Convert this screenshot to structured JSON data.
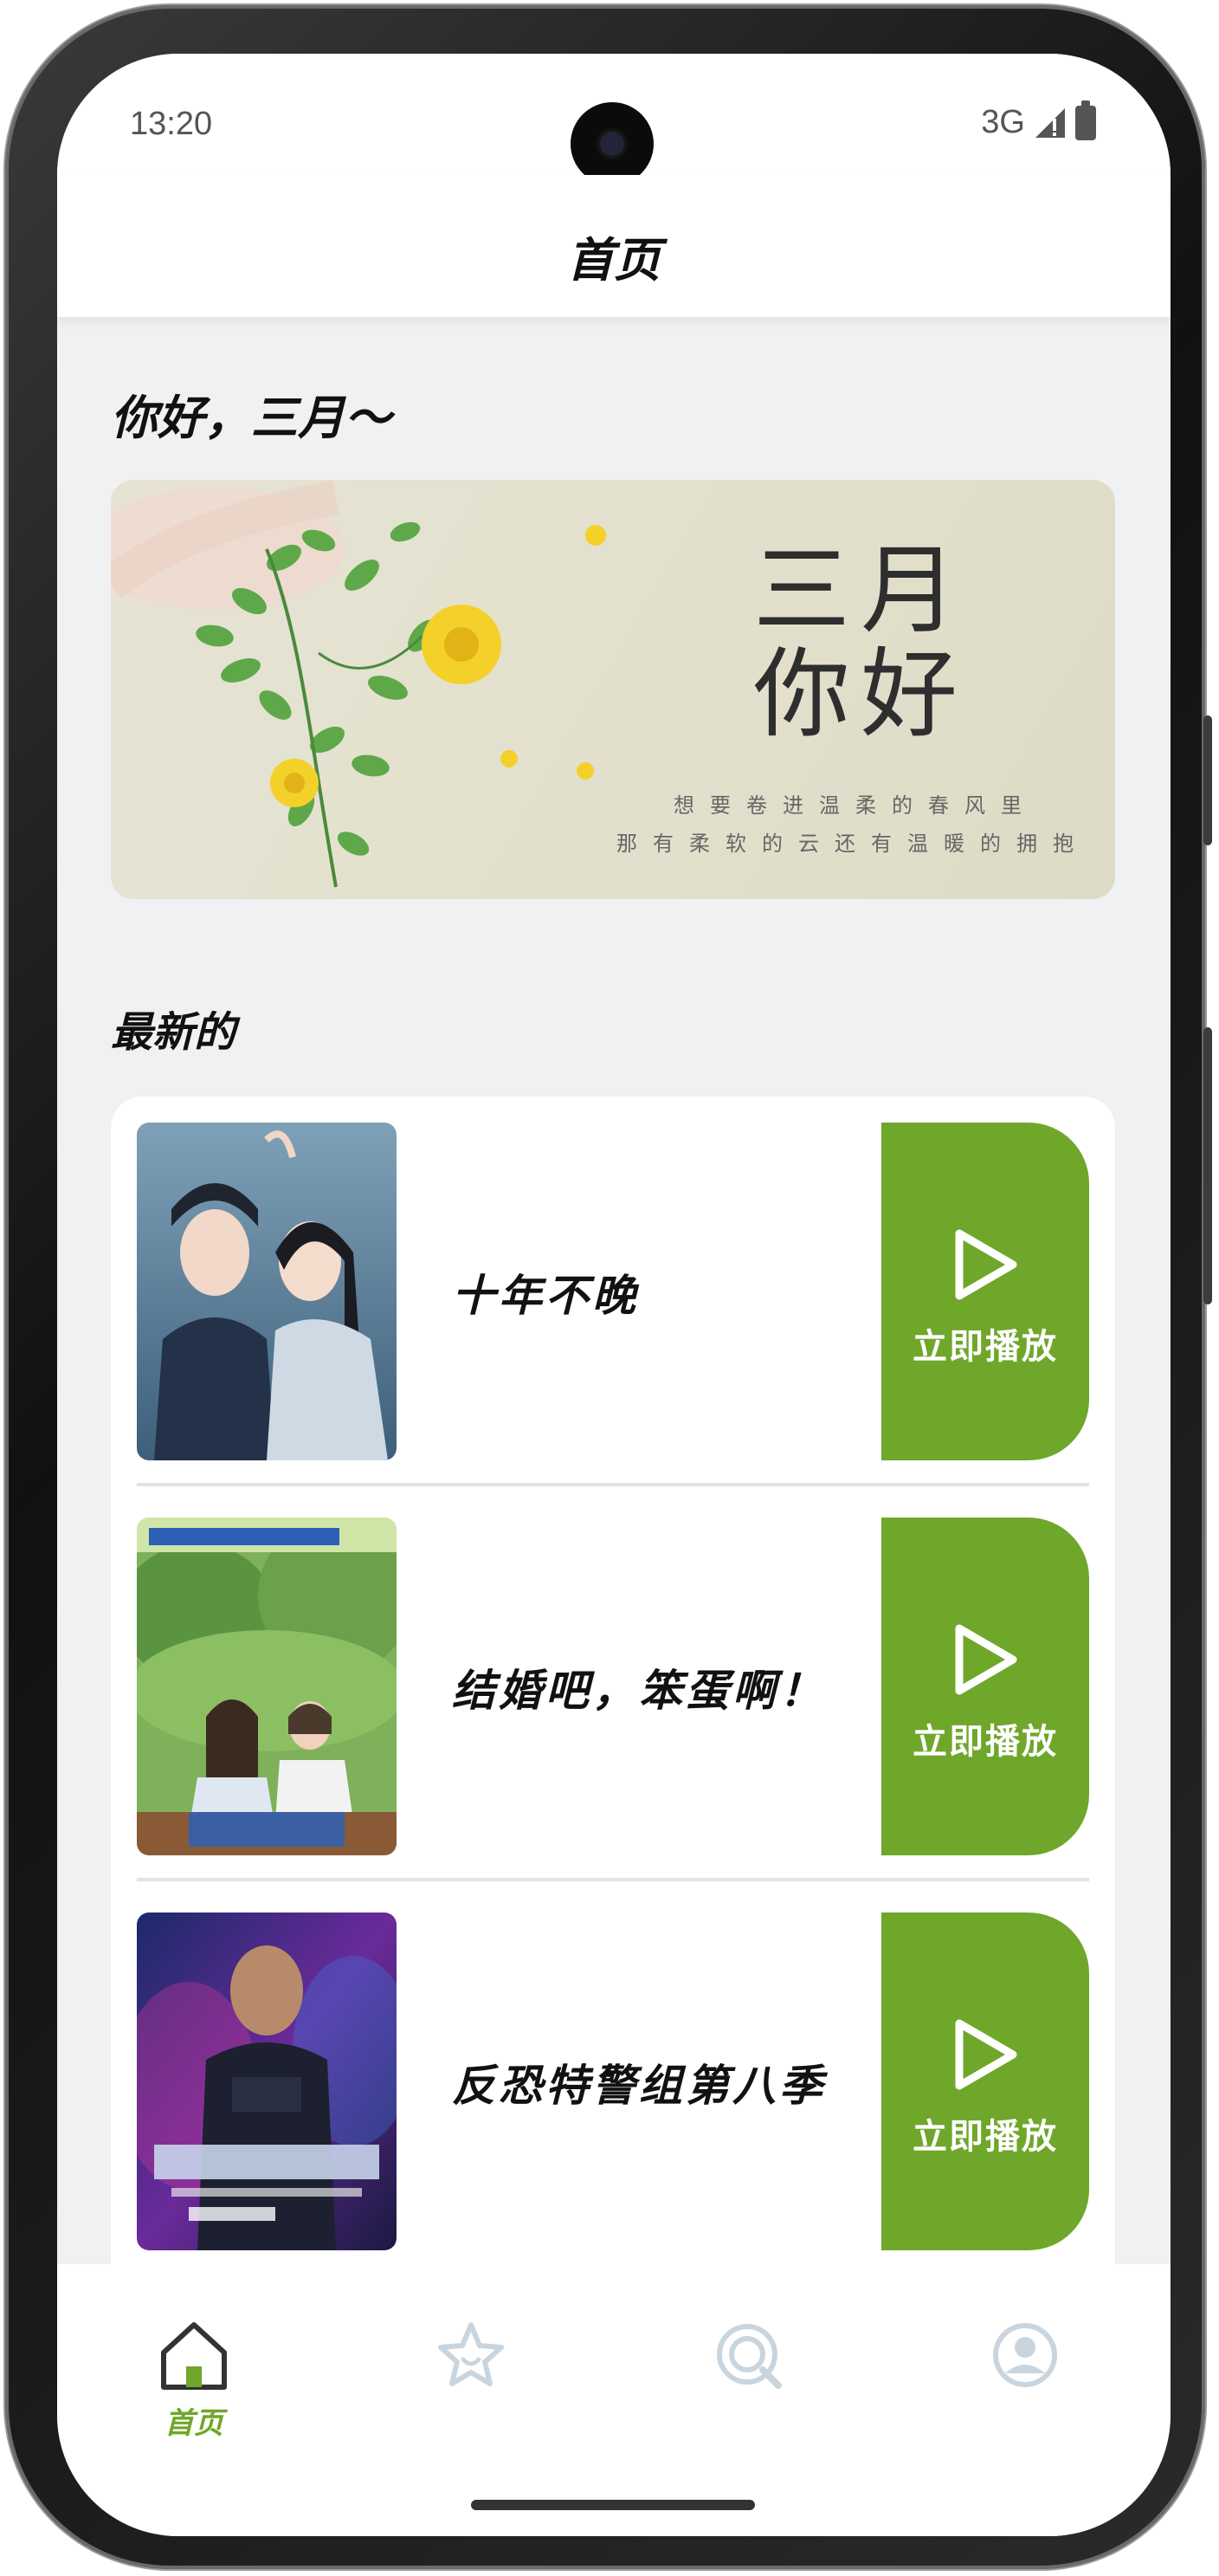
{
  "status_bar": {
    "time": "13:20",
    "network": "3G"
  },
  "header": {
    "title": "首页"
  },
  "greeting": "你好，三月～",
  "banner": {
    "title_line1": "三月",
    "title_line2": "你好",
    "subtitle_line1": "想要卷进温柔的春风里",
    "subtitle_line2": "那有柔软的云还有温暖的拥抱"
  },
  "latest": {
    "section_title": "最新的",
    "play_label": "立即播放",
    "items": [
      {
        "title": "十年不晚"
      },
      {
        "title": "结婚吧，笨蛋啊！"
      },
      {
        "title": "反恐特警组第八季"
      }
    ]
  },
  "bottom_nav": {
    "items": [
      {
        "label": "首页",
        "icon": "home-icon",
        "active": true
      },
      {
        "label": "",
        "icon": "star-icon",
        "active": false
      },
      {
        "label": "",
        "icon": "search-icon",
        "active": false
      },
      {
        "label": "",
        "icon": "profile-icon",
        "active": false
      }
    ]
  },
  "colors": {
    "accent": "#6fa72a",
    "background": "#f0f1f3"
  }
}
